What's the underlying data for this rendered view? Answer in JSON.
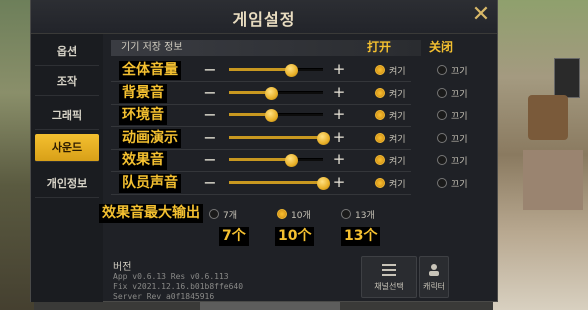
{
  "window": {
    "title": "게임설정"
  },
  "sidebar": {
    "items": [
      {
        "label": "옵션",
        "active": false
      },
      {
        "label": "조작",
        "active": false
      },
      {
        "label": "그래픽",
        "active": false
      },
      {
        "label": "사운드",
        "active": true
      },
      {
        "label": "개인정보",
        "active": false
      }
    ]
  },
  "sound": {
    "section_header": "기기 저장 정보",
    "col_on": "打开",
    "col_off": "关闭",
    "on_label": "켜기",
    "off_label": "끄기",
    "rows": [
      {
        "label": "全体音量",
        "volume": 0.66,
        "enabled": true
      },
      {
        "label": "背景音",
        "volume": 0.45,
        "enabled": true
      },
      {
        "label": "环境音",
        "volume": 0.45,
        "enabled": true
      },
      {
        "label": "动画演示",
        "volume": 1.0,
        "enabled": true
      },
      {
        "label": "效果音",
        "volume": 0.66,
        "enabled": true
      },
      {
        "label": "队员声音",
        "volume": 1.0,
        "enabled": true
      }
    ],
    "max_output": {
      "label": "效果音最大输出",
      "options": [
        {
          "label": "7개",
          "annotation": "7个",
          "selected": false
        },
        {
          "label": "10개",
          "annotation": "10个",
          "selected": true
        },
        {
          "label": "13개",
          "annotation": "13个",
          "selected": false
        }
      ]
    }
  },
  "version": {
    "title": "버전",
    "lines": [
      "App v0.6.13 Res v0.6.113",
      "Fix v2021.12.16.b01b8ffe640",
      "Server Rev a0f1845916"
    ]
  },
  "buttons": {
    "channel_label": "채널선택",
    "character_label": "캐릭터"
  },
  "colors": {
    "accent": "#f4c030",
    "panel": "#1f2126"
  }
}
